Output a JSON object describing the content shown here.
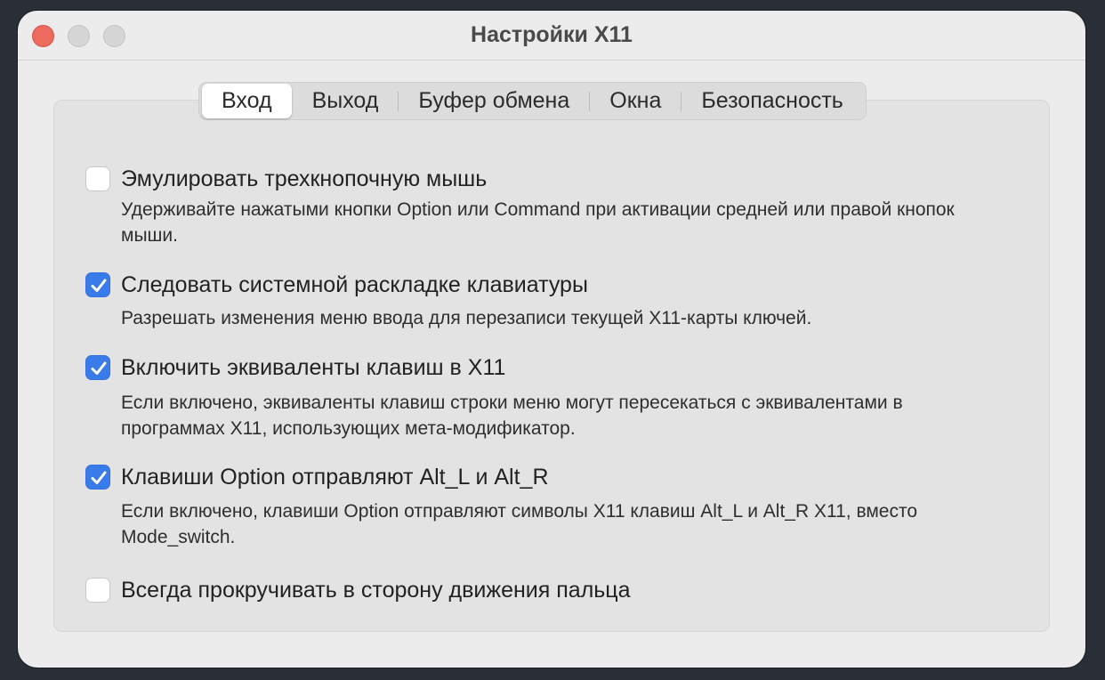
{
  "window": {
    "title": "Настройки X11"
  },
  "tabs": [
    {
      "label": "Вход",
      "active": true
    },
    {
      "label": "Выход",
      "active": false
    },
    {
      "label": "Буфер обмена",
      "active": false
    },
    {
      "label": "Окна",
      "active": false
    },
    {
      "label": "Безопасность",
      "active": false
    }
  ],
  "options": [
    {
      "label": "Эмулировать трехкнопочную мышь",
      "checked": false,
      "description": "Удерживайте нажатыми кнопки Option или Command при активации средней или правой кнопок мыши."
    },
    {
      "label": "Следовать системной раскладке клавиатуры",
      "checked": true,
      "description": "Разрешать изменения меню ввода для перезаписи текущей X11-карты ключей."
    },
    {
      "label": "Включить эквиваленты клавиш в X11",
      "checked": true,
      "description": "Если включено, эквиваленты клавиш строки меню могут пересекаться с эквивалентами в программах X11, использующих мета-модификатор."
    },
    {
      "label": "Клавиши Option отправляют Alt_L и Alt_R",
      "checked": true,
      "description": "Если включено, клавиши Option отправляют символы X11 клавиш Alt_L и Alt_R X11, вместо Mode_switch."
    },
    {
      "label": "Всегда прокручивать в сторону движения пальца",
      "checked": false,
      "description": ""
    }
  ],
  "colors": {
    "accent": "#3a7bea",
    "close": "#ed6a5e"
  }
}
